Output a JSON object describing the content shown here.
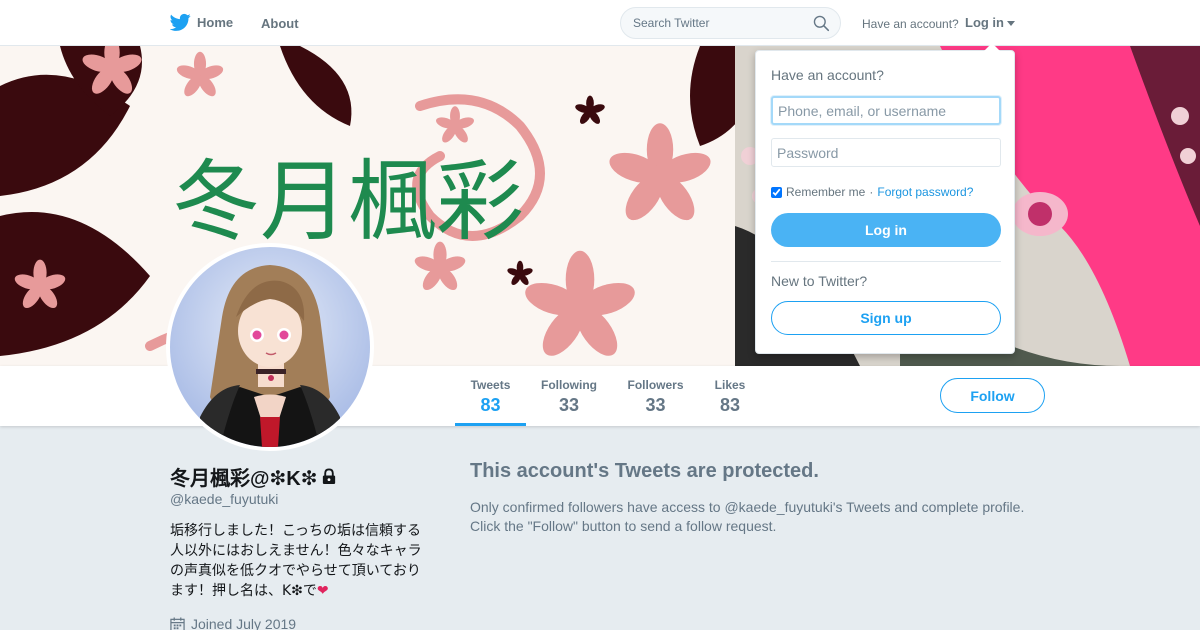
{
  "nav": {
    "home_label": "Home",
    "about_label": "About",
    "search_placeholder": "Search Twitter",
    "have_account": "Have an account?",
    "login_label": "Log in"
  },
  "banner": {
    "title_text": "冬月楓彩"
  },
  "stats": [
    {
      "label": "Tweets",
      "value": "83"
    },
    {
      "label": "Following",
      "value": "33"
    },
    {
      "label": "Followers",
      "value": "33"
    },
    {
      "label": "Likes",
      "value": "83"
    }
  ],
  "follow_label": "Follow",
  "profile": {
    "name": "冬月楓彩@❇K❇",
    "handle": "@kaede_fuyutuki",
    "bio_lines": [
      "垢移行しました！こっちの垢は信頼する",
      "人以外にはおしえません！色々なキャラ",
      "の声真似を低クオでやらせて頂いており",
      "ます！押し名は、K❇で"
    ],
    "bio_heart": "❤",
    "joined": "Joined July 2019"
  },
  "protected": {
    "title": "This account's Tweets are protected.",
    "line1": "Only confirmed followers have access to @kaede_fuyutuki's Tweets and complete profile.",
    "line2": "Click the \"Follow\" button to send a follow request."
  },
  "login_dropdown": {
    "heading": "Have an account?",
    "username_placeholder": "Phone, email, or username",
    "password_placeholder": "Password",
    "remember_label": "Remember me",
    "separator": "·",
    "forgot_label": "Forgot password?",
    "login_button": "Log in",
    "new_to_twitter": "New to Twitter?",
    "signup_button": "Sign up"
  },
  "colors": {
    "accent": "#1da1f2",
    "login_button": "#4ab3f4",
    "banner_text_green": "#1e8a4f",
    "banner_flower_pink": "#e79a9a",
    "banner_flower_dark": "#3a0a0e"
  },
  "icons": [
    "twitter-bird-icon",
    "search-icon",
    "caret-down-icon",
    "lock-icon",
    "calendar-icon"
  ]
}
